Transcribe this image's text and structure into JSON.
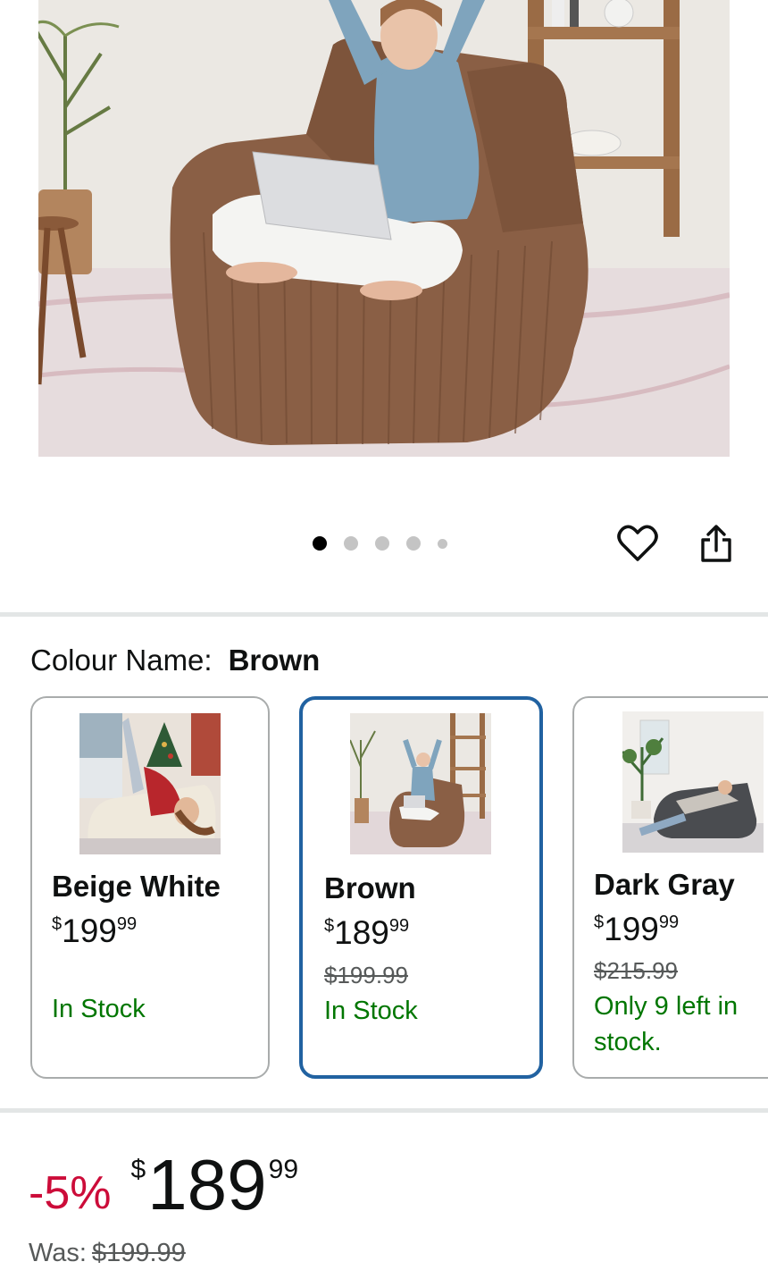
{
  "gallery": {
    "dot_count": 5,
    "active_index": 0
  },
  "actions": {
    "wishlist_icon": "heart-icon",
    "share_icon": "share-icon"
  },
  "colour": {
    "label": "Colour Name:",
    "selected": "Brown"
  },
  "variants": [
    {
      "name": "Beige White",
      "currency": "$",
      "whole": "199",
      "fraction": "99",
      "was": "",
      "stock": "In Stock",
      "selected": false
    },
    {
      "name": "Brown",
      "currency": "$",
      "whole": "189",
      "fraction": "99",
      "was": "$199.99",
      "stock": "In Stock",
      "selected": true
    },
    {
      "name": "Dark Gray",
      "currency": "$",
      "whole": "199",
      "fraction": "99",
      "was": "$215.99",
      "stock": "Only 9 left in stock.",
      "selected": false
    }
  ],
  "price": {
    "discount": "-5%",
    "currency": "$",
    "whole": "189",
    "fraction": "99",
    "was_label": "Was:",
    "was_value": "$199.99"
  },
  "colors": {
    "deal_red": "#cc0c39",
    "stock_green": "#007600",
    "selected_border": "#2162a1"
  }
}
